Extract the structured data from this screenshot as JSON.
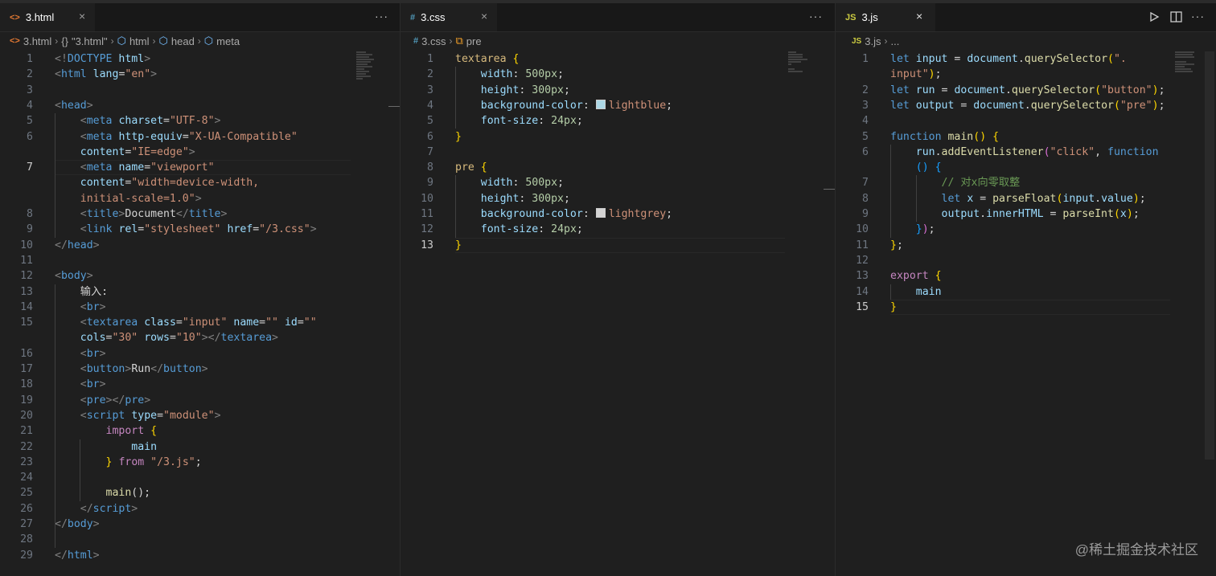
{
  "panes": [
    {
      "tab": {
        "label": "3.html",
        "icon_text": "<>",
        "icon_color": "#e37933",
        "close": "×"
      },
      "more": "···",
      "breadcrumb": [
        "3.html",
        "\"3.html\"",
        "html",
        "head",
        "meta"
      ],
      "breadcrumb_icons": [
        "<>",
        "{}",
        "⬡",
        "⬡",
        "⬡"
      ],
      "line_numbers": [
        "1",
        "2",
        "3",
        "4",
        "5",
        "6",
        "",
        "7",
        "",
        "",
        "8",
        "9",
        "10",
        "11",
        "12",
        "13",
        "14",
        "15",
        "",
        "16",
        "17",
        "18",
        "19",
        "20",
        "21",
        "22",
        "23",
        "24",
        "25",
        "26",
        "27",
        "28",
        "29"
      ],
      "current_line": "7"
    },
    {
      "tab": {
        "label": "3.css",
        "icon_text": "#",
        "icon_color": "#519aba",
        "close": "×"
      },
      "more": "···",
      "breadcrumb": [
        "3.css",
        "pre"
      ],
      "breadcrumb_icons": [
        "#",
        "⧉"
      ],
      "line_numbers": [
        "1",
        "2",
        "3",
        "4",
        "5",
        "6",
        "7",
        "8",
        "9",
        "10",
        "11",
        "12",
        "13"
      ],
      "current_line": "13"
    },
    {
      "tab": {
        "label": "3.js",
        "icon_text": "JS",
        "icon_color": "#cbcb41",
        "close": "×"
      },
      "breadcrumb": [
        "3.js",
        "..."
      ],
      "breadcrumb_icons": [
        "JS",
        ""
      ],
      "line_numbers": [
        "1",
        "",
        "2",
        "3",
        "4",
        "5",
        "6",
        "",
        "7",
        "8",
        "9",
        "10",
        "11",
        "12",
        "13",
        "14",
        "15"
      ],
      "current_line": "15"
    }
  ],
  "toolbar": {
    "run_icon": "play-icon",
    "split_icon": "split-editor-icon",
    "more": "···"
  },
  "watermark": "@稀土掘金技术社区",
  "html_code": [
    [
      [
        "tag-b",
        "<!"
      ],
      [
        "tag",
        "DOCTYPE"
      ],
      [
        "txt",
        " "
      ],
      [
        "attr",
        "html"
      ],
      [
        "tag-b",
        ">"
      ]
    ],
    [
      [
        "tag-b",
        "<"
      ],
      [
        "tag",
        "html"
      ],
      [
        "txt",
        " "
      ],
      [
        "attr",
        "lang"
      ],
      [
        "txt",
        "="
      ],
      [
        "str",
        "\"en\""
      ],
      [
        "tag-b",
        ">"
      ]
    ],
    [],
    [
      [
        "tag-b",
        "<"
      ],
      [
        "tag",
        "head"
      ],
      [
        "tag-b",
        ">"
      ]
    ],
    [
      [
        "txt",
        "    "
      ],
      [
        "tag-b",
        "<"
      ],
      [
        "tag",
        "meta"
      ],
      [
        "txt",
        " "
      ],
      [
        "attr",
        "charset"
      ],
      [
        "txt",
        "="
      ],
      [
        "str",
        "\"UTF-8\""
      ],
      [
        "tag-b",
        ">"
      ]
    ],
    [
      [
        "txt",
        "    "
      ],
      [
        "tag-b",
        "<"
      ],
      [
        "tag",
        "meta"
      ],
      [
        "txt",
        " "
      ],
      [
        "attr",
        "http-equiv"
      ],
      [
        "txt",
        "="
      ],
      [
        "str",
        "\"X-UA-Compatible\""
      ]
    ],
    [
      [
        "txt",
        "    "
      ],
      [
        "attr",
        "content"
      ],
      [
        "txt",
        "="
      ],
      [
        "str",
        "\"IE=edge\""
      ],
      [
        "tag-b",
        ">"
      ]
    ],
    [
      [
        "txt",
        "    "
      ],
      [
        "tag-b",
        "<"
      ],
      [
        "tag",
        "meta"
      ],
      [
        "txt",
        " "
      ],
      [
        "attr",
        "name"
      ],
      [
        "txt",
        "="
      ],
      [
        "str",
        "\"viewport\""
      ]
    ],
    [
      [
        "txt",
        "    "
      ],
      [
        "attr",
        "content"
      ],
      [
        "txt",
        "="
      ],
      [
        "str",
        "\"width=device-width,"
      ]
    ],
    [
      [
        "txt",
        "    "
      ],
      [
        "str",
        "initial-scale=1.0\""
      ],
      [
        "tag-b",
        ">"
      ]
    ],
    [
      [
        "txt",
        "    "
      ],
      [
        "tag-b",
        "<"
      ],
      [
        "tag",
        "title"
      ],
      [
        "tag-b",
        ">"
      ],
      [
        "txt",
        "Document"
      ],
      [
        "tag-b",
        "</"
      ],
      [
        "tag",
        "title"
      ],
      [
        "tag-b",
        ">"
      ]
    ],
    [
      [
        "txt",
        "    "
      ],
      [
        "tag-b",
        "<"
      ],
      [
        "tag",
        "link"
      ],
      [
        "txt",
        " "
      ],
      [
        "attr",
        "rel"
      ],
      [
        "txt",
        "="
      ],
      [
        "str",
        "\"stylesheet\""
      ],
      [
        "txt",
        " "
      ],
      [
        "attr",
        "href"
      ],
      [
        "txt",
        "="
      ],
      [
        "str",
        "\"/3.css\""
      ],
      [
        "tag-b",
        ">"
      ]
    ],
    [
      [
        "tag-b",
        "</"
      ],
      [
        "tag",
        "head"
      ],
      [
        "tag-b",
        ">"
      ]
    ],
    [],
    [
      [
        "tag-b",
        "<"
      ],
      [
        "tag",
        "body"
      ],
      [
        "tag-b",
        ">"
      ]
    ],
    [
      [
        "txt",
        "    输入:"
      ]
    ],
    [
      [
        "txt",
        "    "
      ],
      [
        "tag-b",
        "<"
      ],
      [
        "tag",
        "br"
      ],
      [
        "tag-b",
        ">"
      ]
    ],
    [
      [
        "txt",
        "    "
      ],
      [
        "tag-b",
        "<"
      ],
      [
        "tag",
        "textarea"
      ],
      [
        "txt",
        " "
      ],
      [
        "attr",
        "class"
      ],
      [
        "txt",
        "="
      ],
      [
        "str",
        "\"input\""
      ],
      [
        "txt",
        " "
      ],
      [
        "attr",
        "name"
      ],
      [
        "txt",
        "="
      ],
      [
        "str",
        "\"\""
      ],
      [
        "txt",
        " "
      ],
      [
        "attr",
        "id"
      ],
      [
        "txt",
        "="
      ],
      [
        "str",
        "\"\""
      ]
    ],
    [
      [
        "txt",
        "    "
      ],
      [
        "attr",
        "cols"
      ],
      [
        "txt",
        "="
      ],
      [
        "str",
        "\"30\""
      ],
      [
        "txt",
        " "
      ],
      [
        "attr",
        "rows"
      ],
      [
        "txt",
        "="
      ],
      [
        "str",
        "\"10\""
      ],
      [
        "tag-b",
        "></"
      ],
      [
        "tag",
        "textarea"
      ],
      [
        "tag-b",
        ">"
      ]
    ],
    [
      [
        "txt",
        "    "
      ],
      [
        "tag-b",
        "<"
      ],
      [
        "tag",
        "br"
      ],
      [
        "tag-b",
        ">"
      ]
    ],
    [
      [
        "txt",
        "    "
      ],
      [
        "tag-b",
        "<"
      ],
      [
        "tag",
        "button"
      ],
      [
        "tag-b",
        ">"
      ],
      [
        "txt",
        "Run"
      ],
      [
        "tag-b",
        "</"
      ],
      [
        "tag",
        "button"
      ],
      [
        "tag-b",
        ">"
      ]
    ],
    [
      [
        "txt",
        "    "
      ],
      [
        "tag-b",
        "<"
      ],
      [
        "tag",
        "br"
      ],
      [
        "tag-b",
        ">"
      ]
    ],
    [
      [
        "txt",
        "    "
      ],
      [
        "tag-b",
        "<"
      ],
      [
        "tag",
        "pre"
      ],
      [
        "tag-b",
        "></"
      ],
      [
        "tag",
        "pre"
      ],
      [
        "tag-b",
        ">"
      ]
    ],
    [
      [
        "txt",
        "    "
      ],
      [
        "tag-b",
        "<"
      ],
      [
        "tag",
        "script"
      ],
      [
        "txt",
        " "
      ],
      [
        "attr",
        "type"
      ],
      [
        "txt",
        "="
      ],
      [
        "str",
        "\"module\""
      ],
      [
        "tag-b",
        ">"
      ]
    ],
    [
      [
        "txt",
        "        "
      ],
      [
        "kwc",
        "import"
      ],
      [
        "txt",
        " "
      ],
      [
        "brk",
        "{"
      ]
    ],
    [
      [
        "txt",
        "            "
      ],
      [
        "var",
        "main"
      ]
    ],
    [
      [
        "txt",
        "        "
      ],
      [
        "brk",
        "}"
      ],
      [
        "txt",
        " "
      ],
      [
        "kwc",
        "from"
      ],
      [
        "txt",
        " "
      ],
      [
        "str",
        "\"/3.js\""
      ],
      [
        "txt",
        ";"
      ]
    ],
    [],
    [
      [
        "txt",
        "        "
      ],
      [
        "fn",
        "main"
      ],
      [
        "txt",
        "();"
      ]
    ],
    [
      [
        "txt",
        "    "
      ],
      [
        "tag-b",
        "</"
      ],
      [
        "tag",
        "script"
      ],
      [
        "tag-b",
        ">"
      ]
    ],
    [
      [
        "tag-b",
        "</"
      ],
      [
        "tag",
        "body"
      ],
      [
        "tag-b",
        ">"
      ]
    ],
    [],
    [
      [
        "tag-b",
        "</"
      ],
      [
        "tag",
        "html"
      ],
      [
        "tag-b",
        ">"
      ]
    ]
  ],
  "css_code": [
    [
      [
        "sel",
        "textarea"
      ],
      [
        "txt",
        " "
      ],
      [
        "brk",
        "{"
      ]
    ],
    [
      [
        "txt",
        "    "
      ],
      [
        "prop",
        "width"
      ],
      [
        "txt",
        ": "
      ],
      [
        "num",
        "500px"
      ],
      [
        "txt",
        ";"
      ]
    ],
    [
      [
        "txt",
        "    "
      ],
      [
        "prop",
        "height"
      ],
      [
        "txt",
        ": "
      ],
      [
        "num",
        "300px"
      ],
      [
        "txt",
        ";"
      ]
    ],
    [
      [
        "txt",
        "    "
      ],
      [
        "prop",
        "background-color"
      ],
      [
        "txt",
        ": "
      ],
      [
        "swatch",
        "#add8e6"
      ],
      [
        "str",
        "lightblue"
      ],
      [
        "txt",
        ";"
      ]
    ],
    [
      [
        "txt",
        "    "
      ],
      [
        "prop",
        "font-size"
      ],
      [
        "txt",
        ": "
      ],
      [
        "num",
        "24px"
      ],
      [
        "txt",
        ";"
      ]
    ],
    [
      [
        "brk",
        "}"
      ]
    ],
    [],
    [
      [
        "sel",
        "pre"
      ],
      [
        "txt",
        " "
      ],
      [
        "brk",
        "{"
      ]
    ],
    [
      [
        "txt",
        "    "
      ],
      [
        "prop",
        "width"
      ],
      [
        "txt",
        ": "
      ],
      [
        "num",
        "500px"
      ],
      [
        "txt",
        ";"
      ]
    ],
    [
      [
        "txt",
        "    "
      ],
      [
        "prop",
        "height"
      ],
      [
        "txt",
        ": "
      ],
      [
        "num",
        "300px"
      ],
      [
        "txt",
        ";"
      ]
    ],
    [
      [
        "txt",
        "    "
      ],
      [
        "prop",
        "background-color"
      ],
      [
        "txt",
        ": "
      ],
      [
        "swatch",
        "#d3d3d3"
      ],
      [
        "str",
        "lightgrey"
      ],
      [
        "txt",
        ";"
      ]
    ],
    [
      [
        "txt",
        "    "
      ],
      [
        "prop",
        "font-size"
      ],
      [
        "txt",
        ": "
      ],
      [
        "num",
        "24px"
      ],
      [
        "txt",
        ";"
      ]
    ],
    [
      [
        "brk",
        "}"
      ]
    ]
  ],
  "js_code": [
    [
      [
        "kw",
        "let"
      ],
      [
        "txt",
        " "
      ],
      [
        "var",
        "input"
      ],
      [
        "txt",
        " = "
      ],
      [
        "var",
        "document"
      ],
      [
        "txt",
        "."
      ],
      [
        "fn",
        "querySelector"
      ],
      [
        "brk",
        "("
      ],
      [
        "str",
        "\"."
      ]
    ],
    [
      [
        "str",
        "input\""
      ],
      [
        "brk",
        ")"
      ],
      [
        "txt",
        ";"
      ]
    ],
    [
      [
        "kw",
        "let"
      ],
      [
        "txt",
        " "
      ],
      [
        "var",
        "run"
      ],
      [
        "txt",
        " = "
      ],
      [
        "var",
        "document"
      ],
      [
        "txt",
        "."
      ],
      [
        "fn",
        "querySelector"
      ],
      [
        "brk",
        "("
      ],
      [
        "str",
        "\"button\""
      ],
      [
        "brk",
        ")"
      ],
      [
        "txt",
        ";"
      ]
    ],
    [
      [
        "kw",
        "let"
      ],
      [
        "txt",
        " "
      ],
      [
        "var",
        "output"
      ],
      [
        "txt",
        " = "
      ],
      [
        "var",
        "document"
      ],
      [
        "txt",
        "."
      ],
      [
        "fn",
        "querySelector"
      ],
      [
        "brk",
        "("
      ],
      [
        "str",
        "\"pre\""
      ],
      [
        "brk",
        ")"
      ],
      [
        "txt",
        ";"
      ]
    ],
    [],
    [
      [
        "kw",
        "function"
      ],
      [
        "txt",
        " "
      ],
      [
        "fn",
        "main"
      ],
      [
        "brk",
        "()"
      ],
      [
        "txt",
        " "
      ],
      [
        "brk",
        "{"
      ]
    ],
    [
      [
        "txt",
        "    "
      ],
      [
        "var",
        "run"
      ],
      [
        "txt",
        "."
      ],
      [
        "fn",
        "addEventListener"
      ],
      [
        "brk2",
        "("
      ],
      [
        "str",
        "\"click\""
      ],
      [
        "txt",
        ", "
      ],
      [
        "kw",
        "function"
      ]
    ],
    [
      [
        "txt",
        "    "
      ],
      [
        "brk3",
        "()"
      ],
      [
        "txt",
        " "
      ],
      [
        "brk3",
        "{"
      ]
    ],
    [
      [
        "txt",
        "        "
      ],
      [
        "cmt",
        "// 对x向零取整"
      ]
    ],
    [
      [
        "txt",
        "        "
      ],
      [
        "kw",
        "let"
      ],
      [
        "txt",
        " "
      ],
      [
        "var",
        "x"
      ],
      [
        "txt",
        " = "
      ],
      [
        "fn",
        "parseFloat"
      ],
      [
        "brk",
        "("
      ],
      [
        "var",
        "input"
      ],
      [
        "txt",
        "."
      ],
      [
        "var",
        "value"
      ],
      [
        "brk",
        ")"
      ],
      [
        "txt",
        ";"
      ]
    ],
    [
      [
        "txt",
        "        "
      ],
      [
        "var",
        "output"
      ],
      [
        "txt",
        "."
      ],
      [
        "var",
        "innerHTML"
      ],
      [
        "txt",
        " = "
      ],
      [
        "fn",
        "parseInt"
      ],
      [
        "brk",
        "("
      ],
      [
        "var",
        "x"
      ],
      [
        "brk",
        ")"
      ],
      [
        "txt",
        ";"
      ]
    ],
    [
      [
        "txt",
        "    "
      ],
      [
        "brk3",
        "}"
      ],
      [
        "brk2",
        ")"
      ],
      [
        "txt",
        ";"
      ]
    ],
    [
      [
        "brk",
        "}"
      ],
      [
        "txt",
        ";"
      ]
    ],
    [],
    [
      [
        "kwc",
        "export"
      ],
      [
        "txt",
        " "
      ],
      [
        "brk",
        "{"
      ]
    ],
    [
      [
        "txt",
        "    "
      ],
      [
        "var",
        "main"
      ]
    ],
    [
      [
        "brk",
        "}"
      ]
    ]
  ]
}
